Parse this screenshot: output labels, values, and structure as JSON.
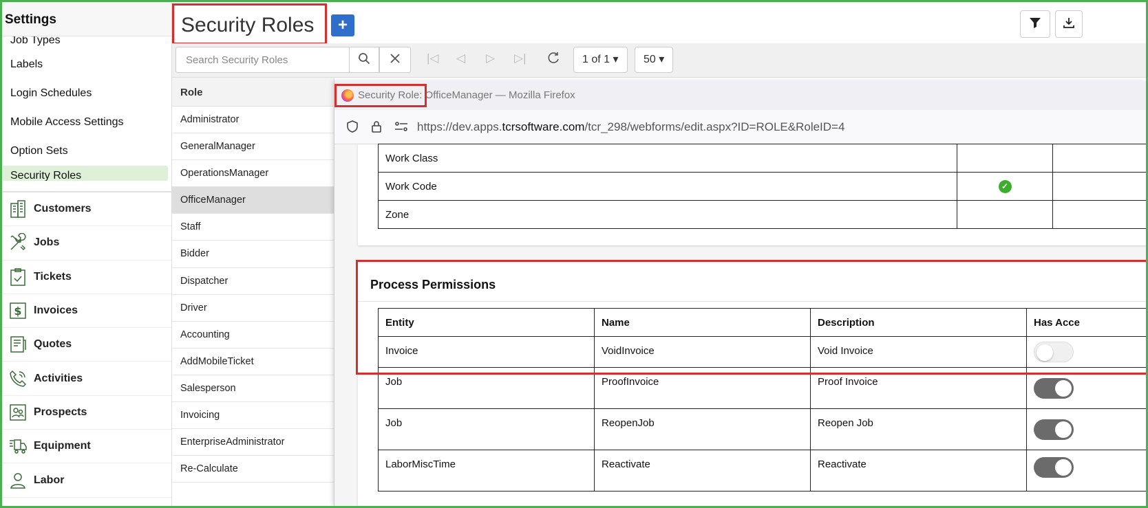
{
  "settings": {
    "title": "Settings",
    "items": [
      "Job Types",
      "Labels",
      "Login Schedules",
      "Mobile Access Settings",
      "Option Sets",
      "Security Roles"
    ]
  },
  "nav": [
    {
      "label": "Customers",
      "icon": "building-icon"
    },
    {
      "label": "Jobs",
      "icon": "tools-icon"
    },
    {
      "label": "Tickets",
      "icon": "clipboard-check-icon"
    },
    {
      "label": "Invoices",
      "icon": "dollar-icon"
    },
    {
      "label": "Quotes",
      "icon": "document-icon"
    },
    {
      "label": "Activities",
      "icon": "phone-icon"
    },
    {
      "label": "Prospects",
      "icon": "contacts-icon"
    },
    {
      "label": "Equipment",
      "icon": "truck-icon"
    },
    {
      "label": "Labor",
      "icon": "person-icon"
    }
  ],
  "header": {
    "title": "Security Roles",
    "add_label": "+"
  },
  "toolbar": {
    "search_placeholder": "Search Security Roles",
    "page_label": "1 of 1 ▾",
    "page_size_label": "50 ▾"
  },
  "roles": {
    "column": "Role",
    "items": [
      "Administrator",
      "GeneralManager",
      "OperationsManager",
      "OfficeManager",
      "Staff",
      "Bidder",
      "Dispatcher",
      "Driver",
      "Accounting",
      "AddMobileTicket",
      "Salesperson",
      "Invoicing",
      "EnterpriseAdministrator",
      "Re-Calculate"
    ],
    "selected": "OfficeManager"
  },
  "popup": {
    "window_title": "Security Role: OfficeManager — Mozilla Firefox",
    "url_prefix": "https://dev.apps.",
    "url_domain": "tcrsoftware.com",
    "url_path": "/tcr_298/webforms/edit.aspx?ID=ROLE&RoleID=4",
    "entity_rows": [
      {
        "name": "Work Class",
        "checked": false
      },
      {
        "name": "Work Code",
        "checked": true
      },
      {
        "name": "Zone",
        "checked": false
      }
    ],
    "process": {
      "title": "Process Permissions",
      "columns": [
        "Entity",
        "Name",
        "Description",
        "Has Acce"
      ],
      "rows": [
        {
          "entity": "Invoice",
          "name": "VoidInvoice",
          "description": "Void Invoice",
          "has_access": false
        },
        {
          "entity": "Job",
          "name": "ProofInvoice",
          "description": "Proof Invoice",
          "has_access": true
        },
        {
          "entity": "Job",
          "name": "ReopenJob",
          "description": "Reopen Job",
          "has_access": true
        },
        {
          "entity": "LaborMiscTime",
          "name": "Reactivate",
          "description": "Reactivate",
          "has_access": true
        }
      ]
    }
  },
  "colors": {
    "accent_green": "#4caf50",
    "highlight_red": "#d32f2f",
    "primary_blue": "#2f6ecb",
    "check_green": "#3dae2b"
  }
}
